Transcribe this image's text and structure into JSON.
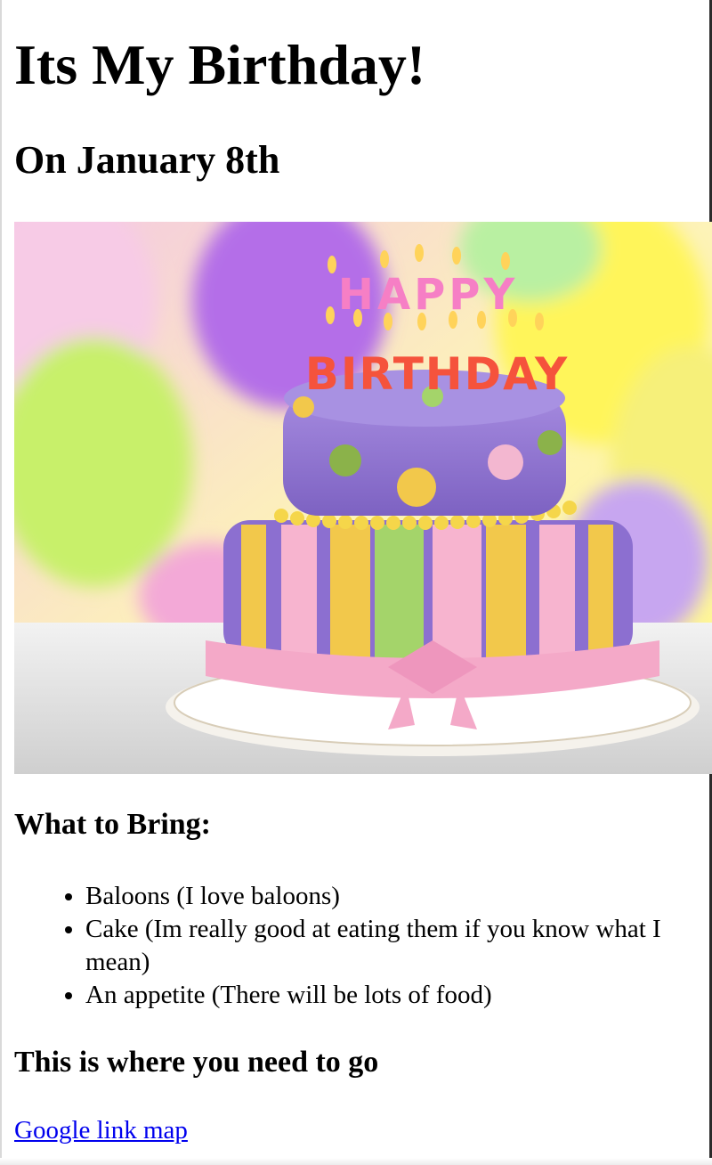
{
  "heading": "Its My Birthday!",
  "subheading": "On January 8th",
  "cake_image": {
    "candle_word_1": "HAPPY",
    "candle_word_2": "BIRTHDAY"
  },
  "bring_heading": "What to Bring:",
  "bring_items": [
    "Baloons (I love baloons)",
    "Cake (Im really good at eating them if you know what I mean)",
    "An appetite (There will be lots of food)"
  ],
  "directions_heading": "This is where you need to go",
  "map_link": "Google link map",
  "colors": {
    "link": "#0000ee",
    "cake_top": "#9a83d6",
    "cake_bottom_stripes": [
      "#8f6fd0",
      "#f2c84b",
      "#a4d46a",
      "#f7b4cf"
    ],
    "ribbon": "#f4a9c8"
  }
}
